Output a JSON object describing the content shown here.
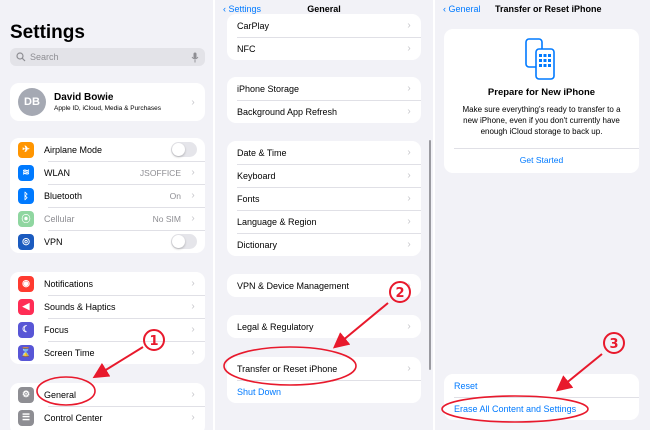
{
  "panel1": {
    "title": "Settings",
    "search_placeholder": "Search",
    "profile": {
      "initials": "DB",
      "name": "David Bowie",
      "subtitle": "Apple ID, iCloud, Media & Purchases"
    },
    "network": [
      {
        "label": "Airplane Mode",
        "value": "",
        "icon": "airplane-icon",
        "color": "#ff9500",
        "glyph": "✈"
      },
      {
        "label": "WLAN",
        "value": "JSOFFICE",
        "icon": "wifi-icon",
        "color": "#007aff",
        "glyph": "≋"
      },
      {
        "label": "Bluetooth",
        "value": "On",
        "icon": "bluetooth-icon",
        "color": "#007aff",
        "glyph": "ᛒ"
      },
      {
        "label": "Cellular",
        "value": "No SIM",
        "icon": "cellular-icon",
        "color": "#8fd6a0",
        "glyph": "⦿"
      },
      {
        "label": "VPN",
        "value": "",
        "icon": "vpn-icon",
        "color": "#1b5bbf",
        "glyph": "◎"
      }
    ],
    "alerts": [
      {
        "label": "Notifications",
        "icon": "notifications-icon",
        "color": "#ff3b30",
        "glyph": "◉"
      },
      {
        "label": "Sounds & Haptics",
        "icon": "speaker-icon",
        "color": "#ff2d55",
        "glyph": "◀"
      },
      {
        "label": "Focus",
        "icon": "moon-icon",
        "color": "#5856d6",
        "glyph": "☾"
      },
      {
        "label": "Screen Time",
        "icon": "hourglass-icon",
        "color": "#5856d6",
        "glyph": "⌛"
      }
    ],
    "general": [
      {
        "label": "General",
        "icon": "gear-icon",
        "color": "#8e8e93",
        "glyph": "⚙"
      },
      {
        "label": "Control Center",
        "icon": "control-center-icon",
        "color": "#8e8e93",
        "glyph": "☰"
      }
    ]
  },
  "panel2": {
    "back_label": "Settings",
    "title": "General",
    "group_a": [
      "CarPlay",
      "NFC"
    ],
    "group_b": [
      "iPhone Storage",
      "Background App Refresh"
    ],
    "group_c": [
      "Date & Time",
      "Keyboard",
      "Fonts",
      "Language & Region",
      "Dictionary"
    ],
    "group_d": [
      "VPN & Device Management"
    ],
    "group_e": [
      "Legal & Regulatory"
    ],
    "group_f": [
      "Transfer or Reset iPhone"
    ],
    "shut_down": "Shut Down"
  },
  "panel3": {
    "back_label": "General",
    "title": "Transfer or Reset iPhone",
    "card_title": "Prepare for New iPhone",
    "card_text": "Make sure everything's ready to transfer to a new iPhone, even if you don't currently have enough iCloud storage to back up.",
    "card_action": "Get Started",
    "reset": "Reset",
    "erase": "Erase All Content and Settings"
  },
  "annotations": {
    "step1": "1",
    "step2": "2",
    "step3": "3",
    "color": "#e8192c"
  }
}
